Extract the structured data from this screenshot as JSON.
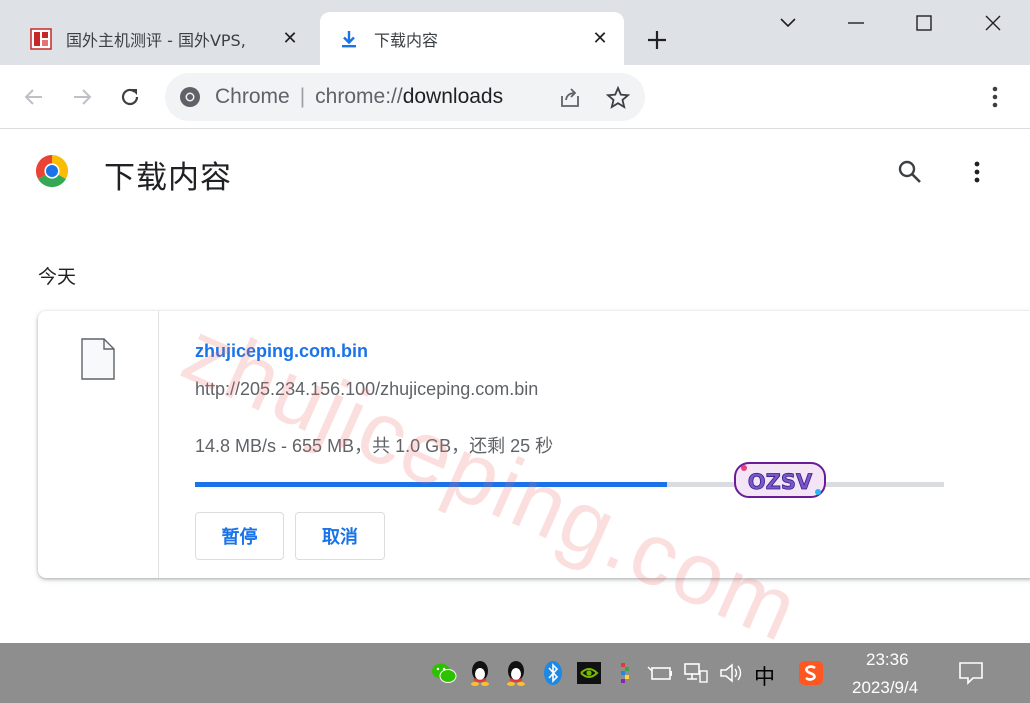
{
  "window": {
    "tabs": [
      {
        "title": "国外主机测评 - 国外VPS,",
        "active": false,
        "favicon": "seal-favicon-icon"
      },
      {
        "title": "下载内容",
        "active": true,
        "favicon": "download-icon"
      }
    ]
  },
  "toolbar": {
    "site_label": "Chrome",
    "url_scheme": "chrome://",
    "url_host": "downloads"
  },
  "page": {
    "title": "下载内容",
    "section_date": "今天"
  },
  "download": {
    "file_name": "zhujiceping.com.bin",
    "url": "http://205.234.156.100/zhujiceping.com.bin",
    "status": "14.8 MB/s - 655 MB，共 1.0 GB，还剩 25 秒",
    "progress_fraction": 0.63,
    "pause_label": "暂停",
    "cancel_label": "取消"
  },
  "overlay": {
    "watermark": "zhujiceping.com",
    "sticker": "OZSV"
  },
  "taskbar": {
    "ime": "中",
    "time": "23:36",
    "date": "2023/9/4"
  },
  "colors": {
    "accent": "#1a73e8",
    "tabstrip": "#dee1e6",
    "taskbar": "#8e8e8e"
  }
}
